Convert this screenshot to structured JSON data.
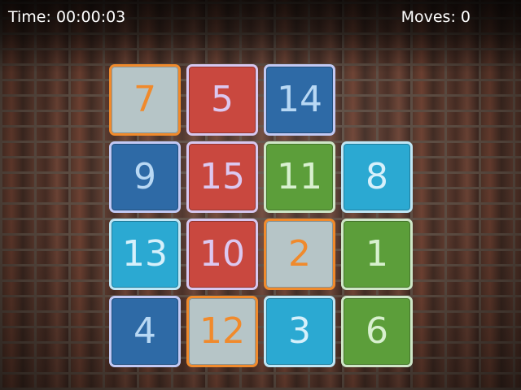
{
  "hud": {
    "time_label": "Time: 00:00:03",
    "moves_label": "Moves: 0"
  },
  "board": {
    "rows": 4,
    "cols": 4,
    "tiles": [
      {
        "label": "7",
        "row": 0,
        "col": 0,
        "color": "gray"
      },
      {
        "label": "5",
        "row": 0,
        "col": 1,
        "color": "red"
      },
      {
        "label": "14",
        "row": 0,
        "col": 2,
        "color": "navy"
      },
      {
        "label": "9",
        "row": 1,
        "col": 0,
        "color": "navy"
      },
      {
        "label": "15",
        "row": 1,
        "col": 1,
        "color": "red"
      },
      {
        "label": "11",
        "row": 1,
        "col": 2,
        "color": "green"
      },
      {
        "label": "8",
        "row": 1,
        "col": 3,
        "color": "sky"
      },
      {
        "label": "13",
        "row": 2,
        "col": 0,
        "color": "sky"
      },
      {
        "label": "10",
        "row": 2,
        "col": 1,
        "color": "red"
      },
      {
        "label": "2",
        "row": 2,
        "col": 2,
        "color": "gray"
      },
      {
        "label": "1",
        "row": 2,
        "col": 3,
        "color": "green"
      },
      {
        "label": "4",
        "row": 3,
        "col": 0,
        "color": "navy"
      },
      {
        "label": "12",
        "row": 3,
        "col": 1,
        "color": "gray"
      },
      {
        "label": "3",
        "row": 3,
        "col": 2,
        "color": "sky"
      },
      {
        "label": "6",
        "row": 3,
        "col": 3,
        "color": "green"
      }
    ],
    "empty_cell": {
      "row": 0,
      "col": 3
    }
  },
  "colors": {
    "red": "#c9483f",
    "navy": "#2e6aa6",
    "sky": "#2ba9d2",
    "green": "#5c9e3a",
    "gray": "#b6c5c7",
    "orange_accent": "#f08a2c"
  }
}
